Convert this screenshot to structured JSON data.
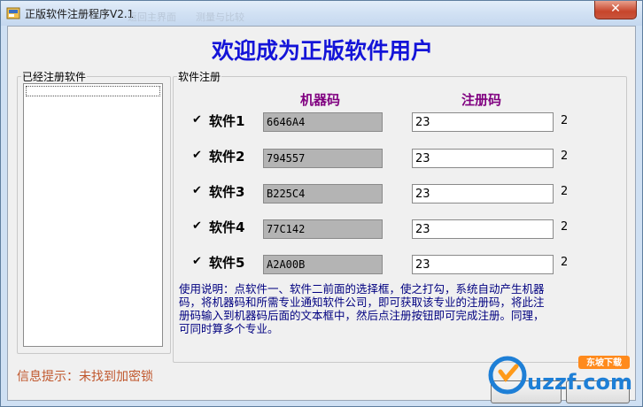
{
  "window": {
    "title": "正版软件注册程序V2.1",
    "close_glyph": "✕",
    "ghost_menu": [
      "返回主界面",
      "测量与比较"
    ]
  },
  "header": {
    "welcome": "欢迎成为正版软件用户"
  },
  "registered_group": {
    "legend": "已经注册软件",
    "items": []
  },
  "register_group": {
    "legend": "软件注册",
    "col_machine": "机器码",
    "col_register": "注册码",
    "rows": [
      {
        "label": "软件1",
        "checked": true,
        "machine_code": "6646A4",
        "register_code": "23",
        "suffix": "2"
      },
      {
        "label": "软件2",
        "checked": true,
        "machine_code": "794557",
        "register_code": "23",
        "suffix": "2"
      },
      {
        "label": "软件3",
        "checked": true,
        "machine_code": "B225C4",
        "register_code": "23",
        "suffix": "2"
      },
      {
        "label": "软件4",
        "checked": true,
        "machine_code": "77C142",
        "register_code": "23",
        "suffix": "2"
      },
      {
        "label": "软件5",
        "checked": true,
        "machine_code": "A2A00B",
        "register_code": "23",
        "suffix": "2"
      }
    ],
    "instructions": "使用说明：点软件一、软件二前面的选择框，使之打勾，系统自动产生机器码，将机器码和所需专业通知软件公司，即可获取该专业的注册码，将此注册码输入到机器码后面的文本框中，然后点注册按钮即可完成注册。同理，可同时算多个专业。"
  },
  "status": {
    "text": "信息提示：未找到加密锁"
  },
  "watermark": {
    "brand": "uzzf.com",
    "badge": "东坡下载"
  },
  "colors": {
    "title_blue": "#1414d8",
    "header_purple": "#800080",
    "status_orange": "#c0572d",
    "instructions_navy": "#000080"
  }
}
